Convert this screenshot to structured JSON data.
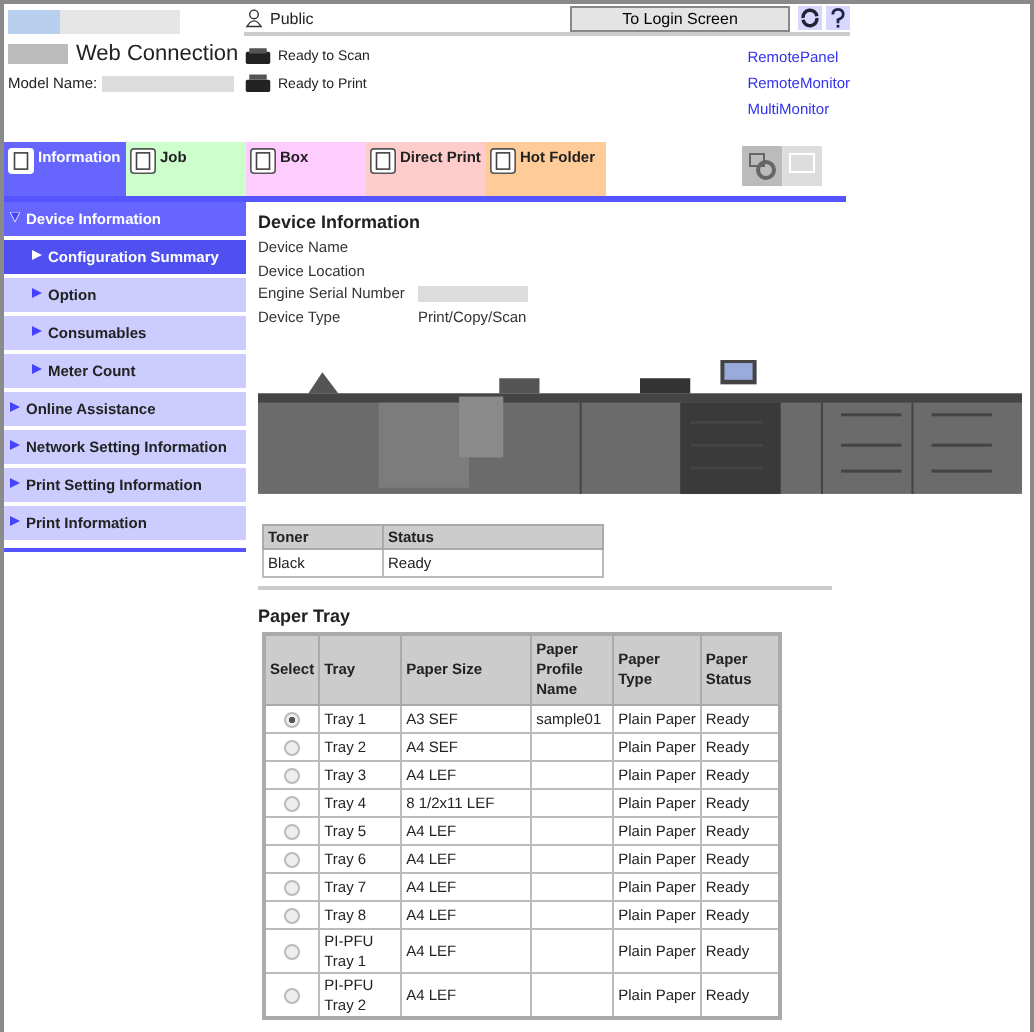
{
  "header": {
    "title": "Web Connection",
    "model_label": "Model Name:",
    "user": "Public",
    "login_button": "To Login Screen",
    "statuses": [
      "Ready to Scan",
      "Ready to Print"
    ],
    "links": [
      "RemotePanel",
      "RemoteMonitor",
      "MultiMonitor"
    ]
  },
  "tabs": [
    {
      "label": "Information",
      "selected": true,
      "color": "#6666ff"
    },
    {
      "label": "Job",
      "selected": false,
      "color": "#ccffcc"
    },
    {
      "label": "Box",
      "selected": false,
      "color": "#ffccff"
    },
    {
      "label": "Direct Print",
      "selected": false,
      "color": "#ffcccc"
    },
    {
      "label": "Hot Folder",
      "selected": false,
      "color": "#ffcc99"
    }
  ],
  "sidebar": {
    "items": [
      {
        "label": "Device Information",
        "expanded": true,
        "selected": false,
        "children": [
          {
            "label": "Configuration Summary",
            "expanded": false,
            "selected": true
          },
          {
            "label": "Option",
            "expanded": false,
            "selected": false
          },
          {
            "label": "Consumables",
            "expanded": false,
            "selected": false
          },
          {
            "label": "Meter Count",
            "expanded": false,
            "selected": false
          }
        ]
      },
      {
        "label": "Online Assistance",
        "expanded": false,
        "selected": false
      },
      {
        "label": "Network Setting Information",
        "expanded": false,
        "selected": false
      },
      {
        "label": "Print Setting Information",
        "expanded": false,
        "selected": false
      },
      {
        "label": "Print Information",
        "expanded": false,
        "selected": false
      }
    ]
  },
  "device": {
    "heading": "Device Information",
    "fields": [
      {
        "label": "Device Name"
      },
      {
        "label": "Device Location"
      },
      {
        "label": "Engine Serial Number"
      },
      {
        "label": "Device Type",
        "value": "Print/Copy/Scan"
      }
    ]
  },
  "toner_table": {
    "columns": [
      "Toner",
      "Status"
    ],
    "rows": [
      [
        "Black",
        "Ready"
      ]
    ]
  },
  "paper_tray": {
    "heading": "Paper Tray",
    "columns": [
      "Select",
      "Tray",
      "Paper Size",
      "Paper Profile Name",
      "Paper Type",
      "Paper Status"
    ],
    "rows": [
      {
        "selected": true,
        "tray": "Tray 1",
        "paper_size": "A3 SEF",
        "paper_profile_name": "sample01",
        "paper_type": "Plain Paper",
        "paper_status": "Ready"
      },
      {
        "selected": false,
        "tray": "Tray 2",
        "paper_size": "A4 SEF",
        "paper_type": "Plain Paper",
        "paper_status": "Ready"
      },
      {
        "selected": false,
        "tray": "Tray 3",
        "paper_size": "A4 LEF",
        "paper_type": "Plain Paper",
        "paper_status": "Ready"
      },
      {
        "selected": false,
        "tray": "Tray 4",
        "paper_size": "8 1/2x11 LEF",
        "paper_type": "Plain Paper",
        "paper_status": "Ready"
      },
      {
        "selected": false,
        "tray": "Tray 5",
        "paper_size": "A4 LEF",
        "paper_type": "Plain Paper",
        "paper_status": "Ready"
      },
      {
        "selected": false,
        "tray": "Tray 6",
        "paper_size": "A4 LEF",
        "paper_type": "Plain Paper",
        "paper_status": "Ready"
      },
      {
        "selected": false,
        "tray": "Tray 7",
        "paper_size": "A4 LEF",
        "paper_type": "Plain Paper",
        "paper_status": "Ready"
      },
      {
        "selected": false,
        "tray": "Tray 8",
        "paper_size": "A4 LEF",
        "paper_type": "Plain Paper",
        "paper_status": "Ready"
      },
      {
        "selected": false,
        "tray": "PI-PFU Tray 1",
        "paper_size": "A4 LEF",
        "paper_type": "Plain Paper",
        "paper_status": "Ready"
      },
      {
        "selected": false,
        "tray": "PI-PFU Tray 2",
        "paper_size": "A4 LEF",
        "paper_type": "Plain Paper",
        "paper_status": "Ready"
      }
    ]
  }
}
